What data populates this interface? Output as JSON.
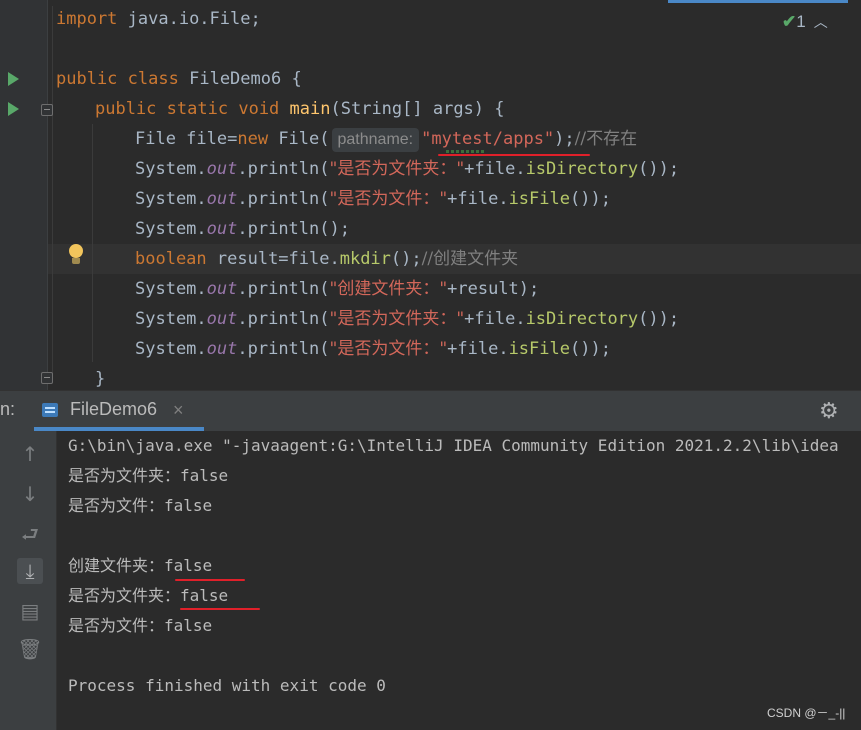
{
  "editor": {
    "inspection_count": "1",
    "lines": {
      "l1": {
        "kw": "import",
        "rest": " java.io.File;"
      },
      "l3": {
        "kw1": "public",
        "kw2": "class",
        "name": "FileDemo6",
        "brace": " {"
      },
      "l4": {
        "kw1": "public",
        "kw2": "static",
        "kw3": "void",
        "fn": "main",
        "rest": "(String[] args) {"
      },
      "l5": {
        "pre": "File file=",
        "kw": "new",
        "post": " File(",
        "hint": "pathname:",
        "str": "\"mytest/apps\"",
        "end": ");",
        "comment": "//不存在"
      },
      "l6": {
        "pre": "System.",
        "out": "out",
        "mid": ".println(",
        "str": "\"是否为文件夹：\"",
        "post1": "+file.",
        "method": "isDirectory",
        "end": "());"
      },
      "l7": {
        "pre": "System.",
        "out": "out",
        "mid": ".println(",
        "str": "\"是否为文件：\"",
        "post1": "+file.",
        "method": "isFile",
        "end": "());"
      },
      "l8": {
        "pre": "System.",
        "out": "out",
        "end": ".println();"
      },
      "l9": {
        "kw": "boolean",
        "pre": " result=file.",
        "method": "mkdir",
        "end": "();",
        "comment": "//创建文件夹"
      },
      "l10": {
        "pre": "System.",
        "out": "out",
        "mid": ".println(",
        "str": "\"创建文件夹：\"",
        "end": "+result);"
      },
      "l11": {
        "pre": "System.",
        "out": "out",
        "mid": ".println(",
        "str": "\"是否为文件夹：\"",
        "post1": "+file.",
        "method": "isDirectory",
        "end": "());"
      },
      "l12": {
        "pre": "System.",
        "out": "out",
        "mid": ".println(",
        "str": "\"是否为文件：\"",
        "post1": "+file.",
        "method": "isFile",
        "end": "());"
      },
      "l13": {
        "brace": "}"
      }
    }
  },
  "run_panel": {
    "label": "n:",
    "tab_label": "FileDemo6",
    "tab_close": "×",
    "icons": [
      "gear-icon",
      "up-arrow-icon",
      "down-arrow-icon",
      "soft-wrap-icon",
      "scroll-to-end-icon",
      "print-icon",
      "trash-icon"
    ],
    "console": {
      "cmd": "G:\\bin\\java.exe \"-javaagent:G:\\IntelliJ IDEA Community Edition 2021.2.2\\lib\\idea",
      "o1_label": "是否为文件夹：",
      "o1_val": "false",
      "o2_label": "是否为文件：",
      "o2_val": "false",
      "o3_label": "创建文件夹：",
      "o3_val": "false",
      "o4_label": "是否为文件夹：",
      "o4_val": "false",
      "o5_label": "是否为文件：",
      "o5_val": "false",
      "finish": "Process finished with exit code 0"
    }
  },
  "watermark": "CSDN @－_-||",
  "colors": {
    "keyword": "#cc7832",
    "string": "#6a8759",
    "highlight_line": "#e0202a",
    "accent": "#4a88c7"
  }
}
